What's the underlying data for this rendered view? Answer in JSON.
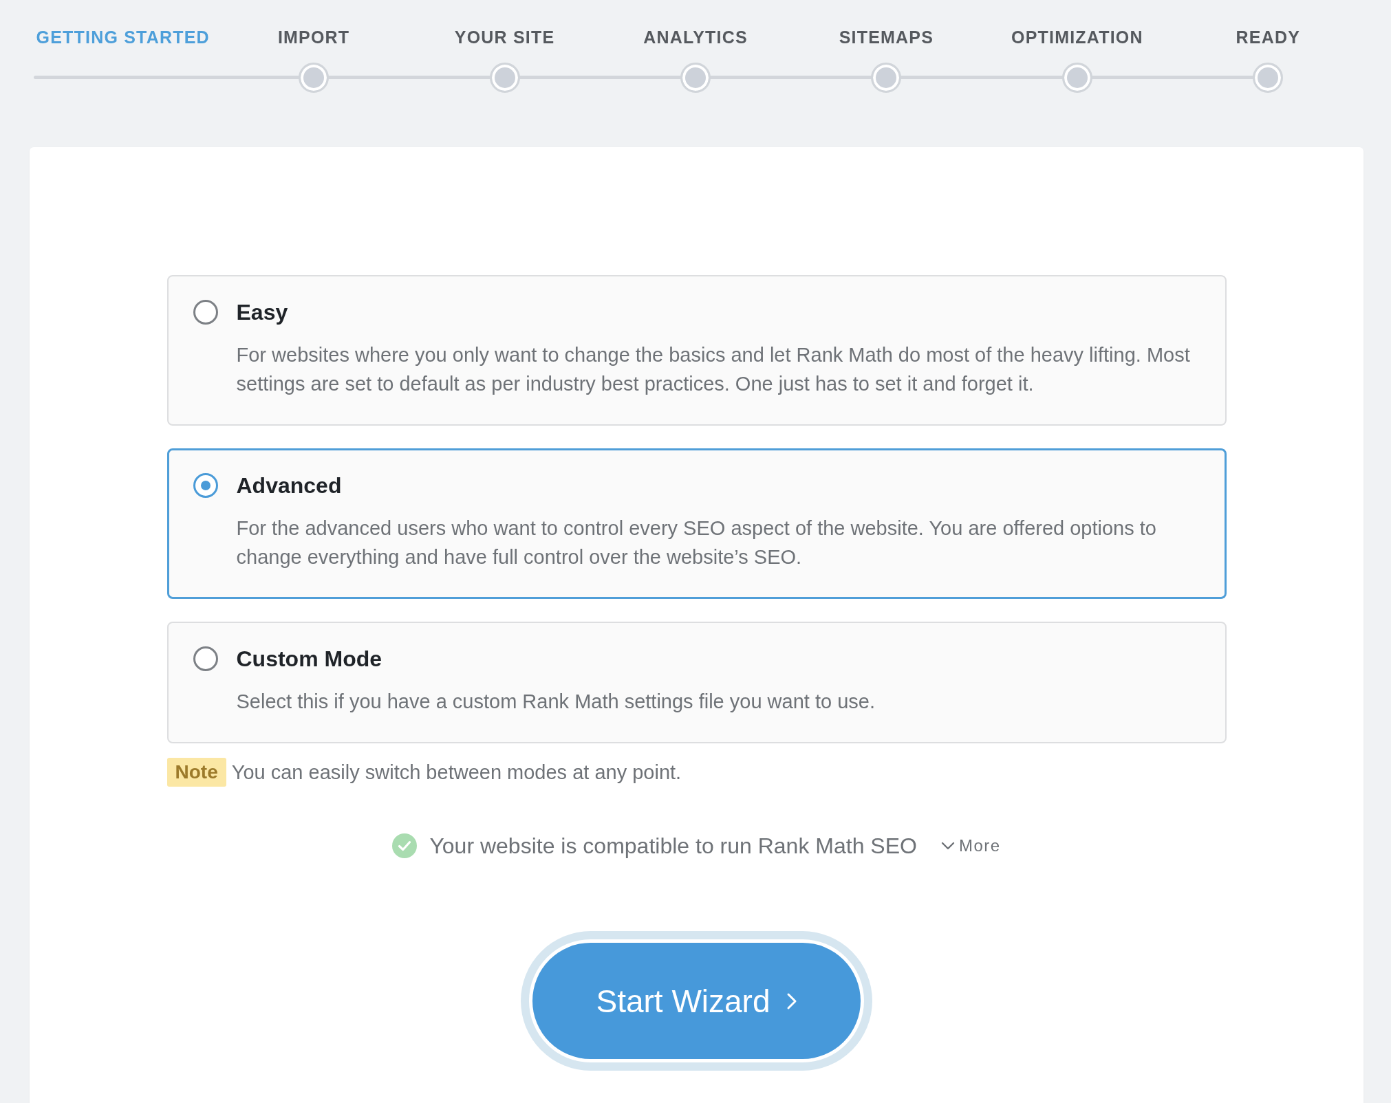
{
  "steps": [
    {
      "label": "GETTING STARTED",
      "selected": true
    },
    {
      "label": "IMPORT",
      "selected": false
    },
    {
      "label": "YOUR SITE",
      "selected": false
    },
    {
      "label": "ANALYTICS",
      "selected": false
    },
    {
      "label": "SITEMAPS",
      "selected": false
    },
    {
      "label": "OPTIMIZATION",
      "selected": false
    },
    {
      "label": "READY",
      "selected": false
    }
  ],
  "modes": [
    {
      "title": "Easy",
      "description": "For websites where you only want to change the basics and let Rank Math do most of the heavy lifting. Most settings are set to default as per industry best practices. One just has to set it and forget it.",
      "selected": false
    },
    {
      "title": "Advanced",
      "description": "For the advanced users who want to control every SEO aspect of the website. You are offered options to change everything and have full control over the website’s SEO.",
      "selected": true
    },
    {
      "title": "Custom Mode",
      "description": "Select this if you have a custom Rank Math settings file you want to use.",
      "selected": false
    }
  ],
  "note": {
    "badge": "Note",
    "text": "You can easily switch between modes at any point."
  },
  "compatibility": {
    "text": "Your website is compatible to run Rank Math SEO",
    "more": "More"
  },
  "start_button": {
    "label": "Start Wizard"
  }
}
